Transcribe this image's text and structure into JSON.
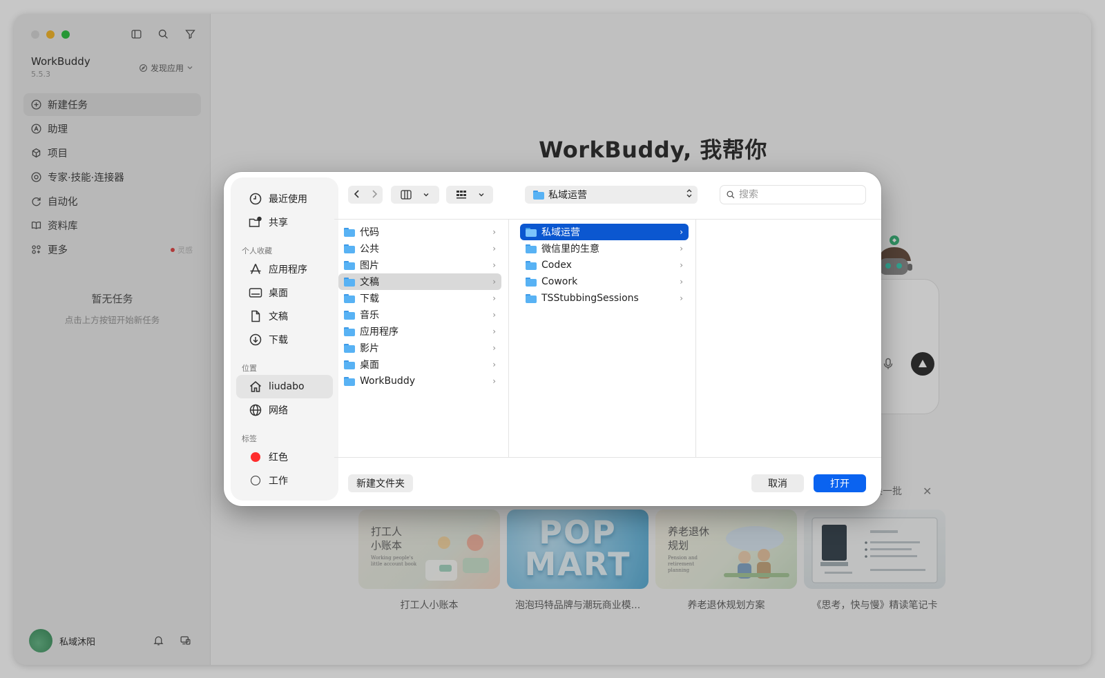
{
  "app": {
    "name": "WorkBuddy",
    "version": "5.5.3",
    "discover_label": "发现应用"
  },
  "sidebar": {
    "items": [
      {
        "label": "新建任务",
        "icon": "plus-circle-icon"
      },
      {
        "label": "助理",
        "icon": "assistant-icon"
      },
      {
        "label": "项目",
        "icon": "project-icon"
      },
      {
        "label": "专家·技能·连接器",
        "icon": "expert-icon"
      },
      {
        "label": "自动化",
        "icon": "automation-icon"
      },
      {
        "label": "资料库",
        "icon": "library-icon"
      },
      {
        "label": "更多",
        "icon": "more-grid-icon",
        "badge": "灵感"
      }
    ],
    "empty_title": "暂无任务",
    "empty_subtitle": "点击上方按钮开始新任务",
    "user_name": "私域沐阳"
  },
  "main": {
    "headline": "WorkBuddy, 我帮你",
    "refresh_label": "换一批",
    "cards": [
      {
        "thumb_title": "打工人\n小账本",
        "thumb_sub": "Working people's little account book",
        "title": "打工人小账本"
      },
      {
        "thumb_title": "POP MART",
        "thumb_sub": "",
        "title": "泡泡玛特品牌与潮玩商业模..."
      },
      {
        "thumb_title": "养老退休\n规划",
        "thumb_sub": "Pension and retirement planning",
        "title": "养老退休规划方案"
      },
      {
        "thumb_title": "",
        "thumb_sub": "",
        "title": "《思考，快与慢》精读笔记卡"
      }
    ]
  },
  "dialog": {
    "sidebar": {
      "top_items": [
        {
          "label": "最近使用",
          "icon": "clock-icon"
        },
        {
          "label": "共享",
          "icon": "shared-folder-icon"
        }
      ],
      "favorites_heading": "个人收藏",
      "favorites": [
        {
          "label": "应用程序",
          "icon": "applications-icon"
        },
        {
          "label": "桌面",
          "icon": "desktop-icon"
        },
        {
          "label": "文稿",
          "icon": "document-icon"
        },
        {
          "label": "下载",
          "icon": "download-icon"
        }
      ],
      "locations_heading": "位置",
      "locations": [
        {
          "label": "liudabo",
          "icon": "home-icon"
        },
        {
          "label": "网络",
          "icon": "globe-icon"
        }
      ],
      "tags_heading": "标签",
      "tags": [
        {
          "label": "红色",
          "color": "#ff2d2d"
        },
        {
          "label": "工作",
          "color": "outline"
        }
      ]
    },
    "current_folder": "私域运营",
    "search_placeholder": "搜索",
    "column1": [
      "代码",
      "公共",
      "图片",
      "文稿",
      "下载",
      "音乐",
      "应用程序",
      "影片",
      "桌面",
      "WorkBuddy"
    ],
    "column1_highlight": "文稿",
    "column2": [
      "私域运营",
      "微信里的生意",
      "Codex",
      "Cowork",
      "TSStubbingSessions"
    ],
    "column2_selected": "私域运营",
    "new_folder_label": "新建文件夹",
    "cancel_label": "取消",
    "open_label": "打开",
    "accent_color": "#0a63f0"
  }
}
